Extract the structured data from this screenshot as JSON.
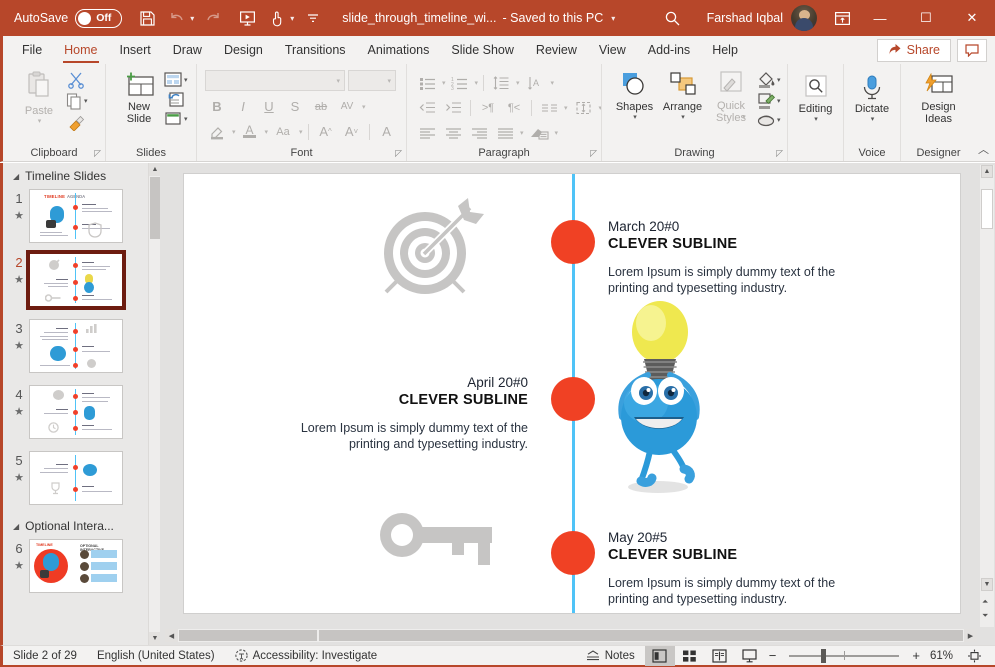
{
  "titlebar": {
    "autosave_label": "AutoSave",
    "autosave_state": "Off",
    "save_icon": "save-icon",
    "undo_icon": "undo-icon",
    "redo_icon": "redo-icon",
    "present_icon": "start-presentation-icon",
    "touch_icon": "touch-mode-icon",
    "customize_icon": "customize-quick-access-icon",
    "document_title": "slide_through_timeline_wi...",
    "saved_state": "-  Saved to this PC",
    "search_icon": "search-icon",
    "user_name": "Farshad Iqbal",
    "avatar": "user-avatar",
    "ribbon_display_icon": "ribbon-display-options-icon",
    "minimize": "—",
    "maximize": "☐",
    "close": "✕"
  },
  "tabs": [
    {
      "label": "File",
      "active": false
    },
    {
      "label": "Home",
      "active": true
    },
    {
      "label": "Insert",
      "active": false
    },
    {
      "label": "Draw",
      "active": false
    },
    {
      "label": "Design",
      "active": false
    },
    {
      "label": "Transitions",
      "active": false
    },
    {
      "label": "Animations",
      "active": false
    },
    {
      "label": "Slide Show",
      "active": false
    },
    {
      "label": "Review",
      "active": false
    },
    {
      "label": "View",
      "active": false
    },
    {
      "label": "Add-ins",
      "active": false
    },
    {
      "label": "Help",
      "active": false
    }
  ],
  "tabs_right": {
    "share_label": "Share",
    "share_icon": "share-icon",
    "comments_icon": "comments-icon"
  },
  "ribbon": {
    "groups": [
      {
        "name": "Clipboard",
        "label": "Clipboard",
        "paste_label": "Paste",
        "cut_icon": "cut-scissors-icon",
        "copy_icon": "copy-icon",
        "format_painter_icon": "format-painter-icon",
        "dialog_launcher": "dialog-box-launcher"
      },
      {
        "name": "Slides",
        "label": "Slides",
        "new_slide_label": "New Slide",
        "layout_icon": "slide-layout-icon",
        "reset_icon": "reset-slide-icon",
        "section_icon": "section-icon"
      },
      {
        "name": "Font",
        "label": "Font",
        "font_name_value": "",
        "font_size_value": "",
        "bold": "B",
        "italic": "I",
        "underline": "U",
        "shadow": "S",
        "strikethrough": "ab",
        "character_spacing": "AV",
        "text_highlight_icon": "text-highlight-color-icon",
        "font_color_icon": "font-color-icon",
        "change_case": "Aa",
        "increase_size": "A",
        "decrease_size": "A",
        "clear_formatting_icon": "clear-formatting-icon",
        "dialog_launcher": "dialog-box-launcher"
      },
      {
        "name": "Paragraph",
        "label": "Paragraph",
        "bullets_icon": "bullets-icon",
        "numbering_icon": "numbering-icon",
        "line_spacing_icon": "line-spacing-icon",
        "text_direction_icon": "text-direction-icon",
        "decrease_indent_icon": "decrease-indent-icon",
        "increase_indent_icon": "increase-indent-icon",
        "rtl_icon": "right-to-left-icon",
        "ltr_icon": "left-to-right-icon",
        "columns_icon": "columns-icon",
        "align_text_icon": "align-text-icon",
        "align_left_icon": "align-left-icon",
        "align_center_icon": "align-center-icon",
        "align_right_icon": "align-right-icon",
        "justify_icon": "justify-icon",
        "smartart_icon": "convert-to-smartart-icon",
        "dialog_launcher": "dialog-box-launcher"
      },
      {
        "name": "Drawing",
        "label": "Drawing",
        "shapes_label": "Shapes",
        "arrange_label": "Arrange",
        "quick_styles_label": "Quick Styles",
        "shape_fill_icon": "shape-fill-icon",
        "shape_outline_icon": "shape-outline-icon",
        "shape_effects_icon": "shape-effects-icon",
        "dialog_launcher": "dialog-box-launcher"
      },
      {
        "name": "Editing",
        "label": "",
        "editing_label": "Editing",
        "editing_icon": "find-magnifier-icon"
      },
      {
        "name": "Voice",
        "label": "Voice",
        "dictate_label": "Dictate",
        "dictate_icon": "microphone-icon"
      },
      {
        "name": "Designer",
        "label": "Designer",
        "design_ideas_label": "Design Ideas",
        "design_ideas_icon": "design-ideas-icon"
      }
    ],
    "collapse_icon": "collapse-ribbon-icon"
  },
  "slide_panel": {
    "sections": [
      {
        "title": "Timeline Slides",
        "slides": [
          {
            "number": "1",
            "star": "★"
          },
          {
            "number": "2",
            "star": "★",
            "selected": true
          },
          {
            "number": "3",
            "star": "★"
          },
          {
            "number": "4",
            "star": "★"
          },
          {
            "number": "5",
            "star": "★"
          }
        ]
      },
      {
        "title": "Optional Intera...",
        "slides": [
          {
            "number": "6",
            "star": "★"
          }
        ]
      }
    ],
    "scroll_up_icon": "scroll-up-icon",
    "scroll_down_icon": "scroll-down-icon"
  },
  "slide": {
    "timeline_color": "#4fc3f7",
    "dot_color": "#f04124",
    "events": [
      {
        "date": "March 20#0",
        "subline": "CLEVER SUBLINE",
        "body": "Lorem Ipsum is simply dummy text of the printing and typesetting industry.",
        "side": "right",
        "icon": "target-with-arrow-icon"
      },
      {
        "date": "April 20#0",
        "subline": "CLEVER SUBLINE",
        "body": "Lorem Ipsum is simply dummy text of the printing and typesetting industry.",
        "side": "left",
        "icon": "lightbulb-character-icon"
      },
      {
        "date": "May 20#5",
        "subline": "CLEVER SUBLINE",
        "body": "Lorem Ipsum is simply dummy text of the printing and typesetting industry.",
        "side": "right",
        "icon": "key-icon"
      }
    ]
  },
  "scrollbars": {
    "left_arrow_icon": "scroll-left-icon",
    "right_arrow_icon": "scroll-right-icon",
    "up_arrow_icon": "scroll-up-icon",
    "down_arrow_icon": "scroll-down-icon",
    "prev_slide_icon": "previous-slide-icon",
    "next_slide_icon": "next-slide-icon"
  },
  "statusbar": {
    "slide_count": "Slide 2 of 29",
    "language": "English (United States)",
    "accessibility": "Accessibility: Investigate",
    "accessibility_icon": "accessibility-icon",
    "notes_label": "Notes",
    "notes_icon": "notes-icon",
    "view_normal_icon": "normal-view-icon",
    "view_sorter_icon": "slide-sorter-icon",
    "view_reading_icon": "reading-view-icon",
    "view_slideshow_icon": "slideshow-view-icon",
    "zoom_out": "−",
    "zoom_in": "+",
    "zoom_level": "61%",
    "fit_icon": "fit-slide-to-window-icon"
  }
}
